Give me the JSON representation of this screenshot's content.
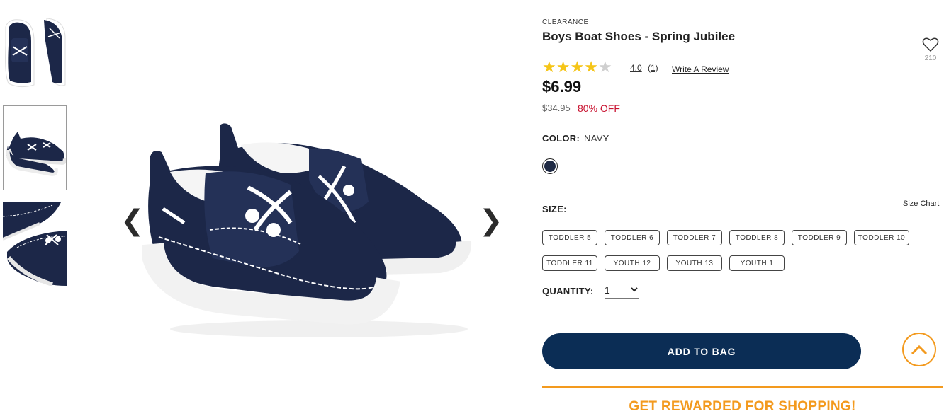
{
  "gallery": {
    "thumbnails": [
      {
        "alt": "shoe-top-view"
      },
      {
        "alt": "shoe-side-pair"
      },
      {
        "alt": "shoe-detail"
      }
    ],
    "selected_index": 1,
    "prev_arrow": "❮",
    "next_arrow": "❯"
  },
  "product": {
    "eyebrow": "CLEARANCE",
    "title": "Boys Boat Shoes - Spring Jubilee",
    "wishlist_count": "210",
    "rating_value": "4.0",
    "rating_count": "(1)",
    "rating_stars": 4,
    "rating_max": 5,
    "write_review": "Write A Review",
    "price": "$6.99",
    "was_price": "$34.95",
    "discount": "80% OFF",
    "discount_color": "#c8102e"
  },
  "color": {
    "label": "COLOR:",
    "value": "NAVY",
    "swatch_color": "#1f2a44"
  },
  "size": {
    "label": "SIZE:",
    "chart_link": "Size Chart",
    "options": [
      "TODDLER 5",
      "TODDLER 6",
      "TODDLER 7",
      "TODDLER 8",
      "TODDLER 9",
      "TODDLER 10",
      "TODDLER 11",
      "YOUTH 12",
      "YOUTH 13",
      "YOUTH 1"
    ]
  },
  "quantity": {
    "label": "QUANTITY:",
    "value": "1"
  },
  "actions": {
    "add_to_bag": "ADD TO BAG",
    "add_to_bag_color": "#0b2d55",
    "accent_color": "#f39a1e"
  },
  "rewards": {
    "text": "GET REWARDED FOR SHOPPING!"
  }
}
